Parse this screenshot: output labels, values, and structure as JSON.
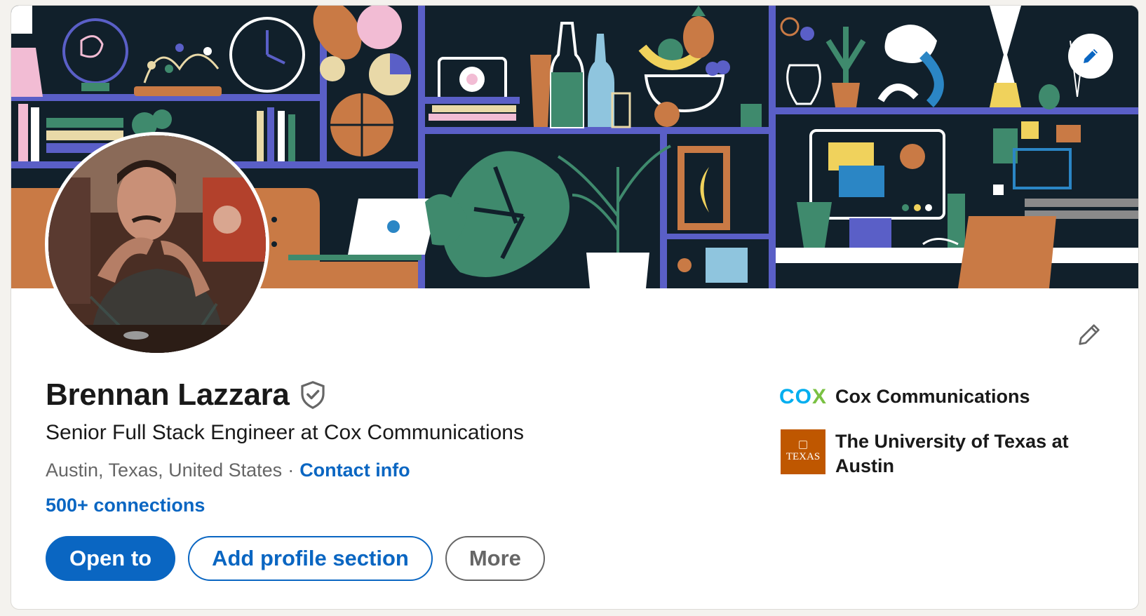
{
  "profile": {
    "name": "Brennan Lazzara",
    "headline": "Senior Full Stack Engineer at Cox Communications",
    "location": "Austin, Texas, United States",
    "separator": "·",
    "contact_info": "Contact info",
    "connections": "500+ connections"
  },
  "actions": {
    "open_to": "Open to",
    "add_section": "Add profile section",
    "more": "More"
  },
  "side": {
    "company": "Cox Communications",
    "company_logo_text": "COX",
    "school": "The University of Texas at Austin",
    "school_logo_text": "TEXAS"
  },
  "colors": {
    "brand_blue": "#0a66c2",
    "banner_bg": "#11202b",
    "texas_orange": "#bf5700",
    "cox_teal": "#00aeef",
    "cox_green": "#7ac143"
  },
  "icons": {
    "banner_edit": "pencil-icon",
    "intro_edit": "pencil-outline-icon",
    "verify": "shield-check-icon"
  }
}
